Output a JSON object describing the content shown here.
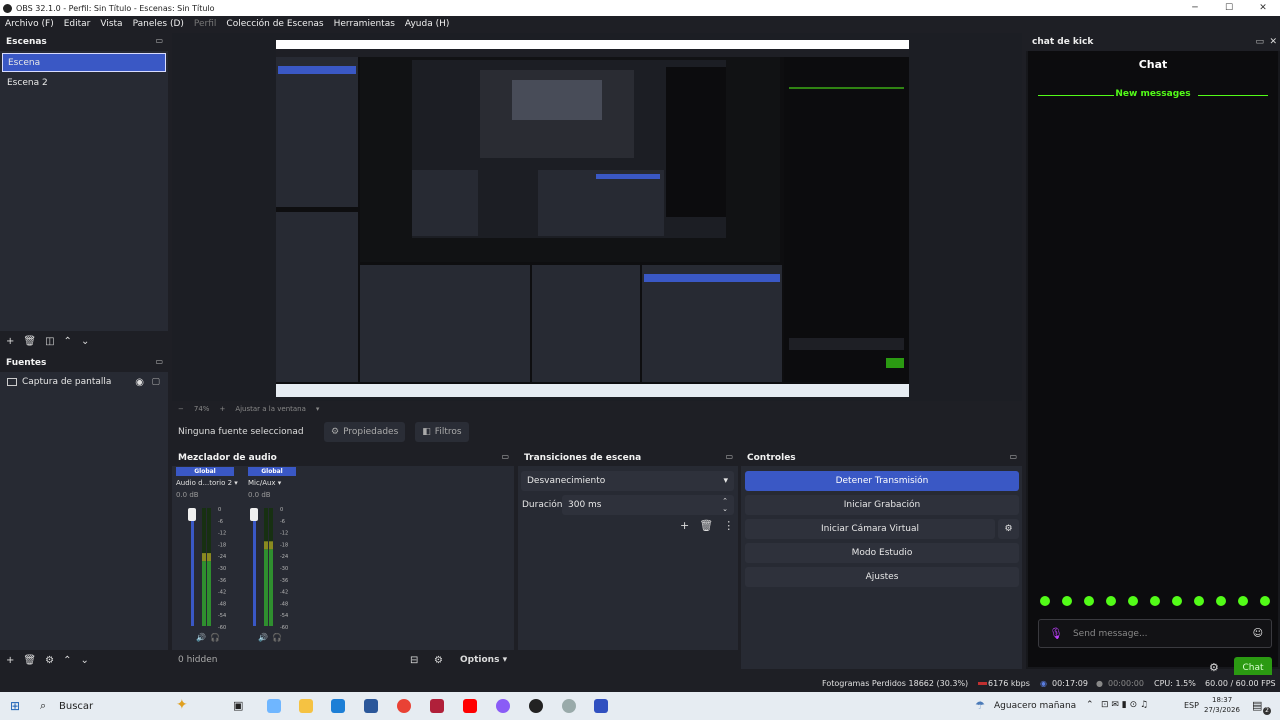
{
  "window": {
    "title": "OBS 32.1.0 - Perfil: Sin Título - Escenas: Sin Título",
    "min": "─",
    "max": "☐",
    "close": "✕"
  },
  "menu": [
    "Archivo (F)",
    "Editar",
    "Vista",
    "Paneles (D)",
    "Perfil",
    "Colección de Escenas",
    "Herramientas",
    "Ayuda (H)"
  ],
  "scenes": {
    "title": "Escenas",
    "items": [
      "Escena",
      "Escena 2"
    ],
    "selected": 0
  },
  "sources": {
    "title": "Fuentes",
    "items": [
      {
        "name": "Captura de pantalla"
      }
    ]
  },
  "preview": {
    "zoom": "74%",
    "fit": "Ajustar a la ventana"
  },
  "source_bar": {
    "none_selected": "Ninguna fuente seleccionad",
    "properties": "Propiedades",
    "filters": "Filtros"
  },
  "audio": {
    "title": "Mezclador de audio",
    "channels": [
      {
        "scope": "Global",
        "name": "Audio d...torio 2",
        "db": "0.0 dB",
        "level": 0.55
      },
      {
        "scope": "Global",
        "name": "Mic/Aux",
        "db": "0.0 dB",
        "level": 0.65
      }
    ],
    "scale": [
      "0",
      "-6",
      "-12",
      "-18",
      "-24",
      "-30",
      "-36",
      "-42",
      "-48",
      "-54",
      "-60"
    ],
    "hidden": "0 hidden",
    "options": "Options"
  },
  "transitions": {
    "title": "Transiciones de escena",
    "selected": "Desvanecimiento",
    "duration_label": "Duración",
    "duration": "300 ms"
  },
  "controls": {
    "title": "Controles",
    "stop_stream": "Detener Transmisión",
    "start_recording": "Iniciar Grabación",
    "start_virtual_cam": "Iniciar Cámara Virtual",
    "studio_mode": "Modo Estudio",
    "settings": "Ajustes"
  },
  "chat": {
    "dock_title": "chat de kick",
    "heading": "Chat",
    "new_messages": "New messages",
    "placeholder": "Send message...",
    "send": "Chat",
    "accent": "#53fc18"
  },
  "status": {
    "dropped": "Fotogramas Perdidos 18662 (30.3%)",
    "bitrate": "6176 kbps",
    "stream_time": "00:17:09",
    "rec_time": "00:00:00",
    "cpu": "CPU: 1.5%",
    "fps": "60.00 / 60.00 FPS"
  },
  "taskbar": {
    "search": "Buscar",
    "weather": "Aguacero mañana",
    "lang": "ESP",
    "time": "18:37",
    "date": "27/3/2026",
    "notif": "2"
  },
  "colors": {
    "accent": "#3a58c5",
    "panel": "#272a33",
    "bg": "#1e1f25"
  }
}
